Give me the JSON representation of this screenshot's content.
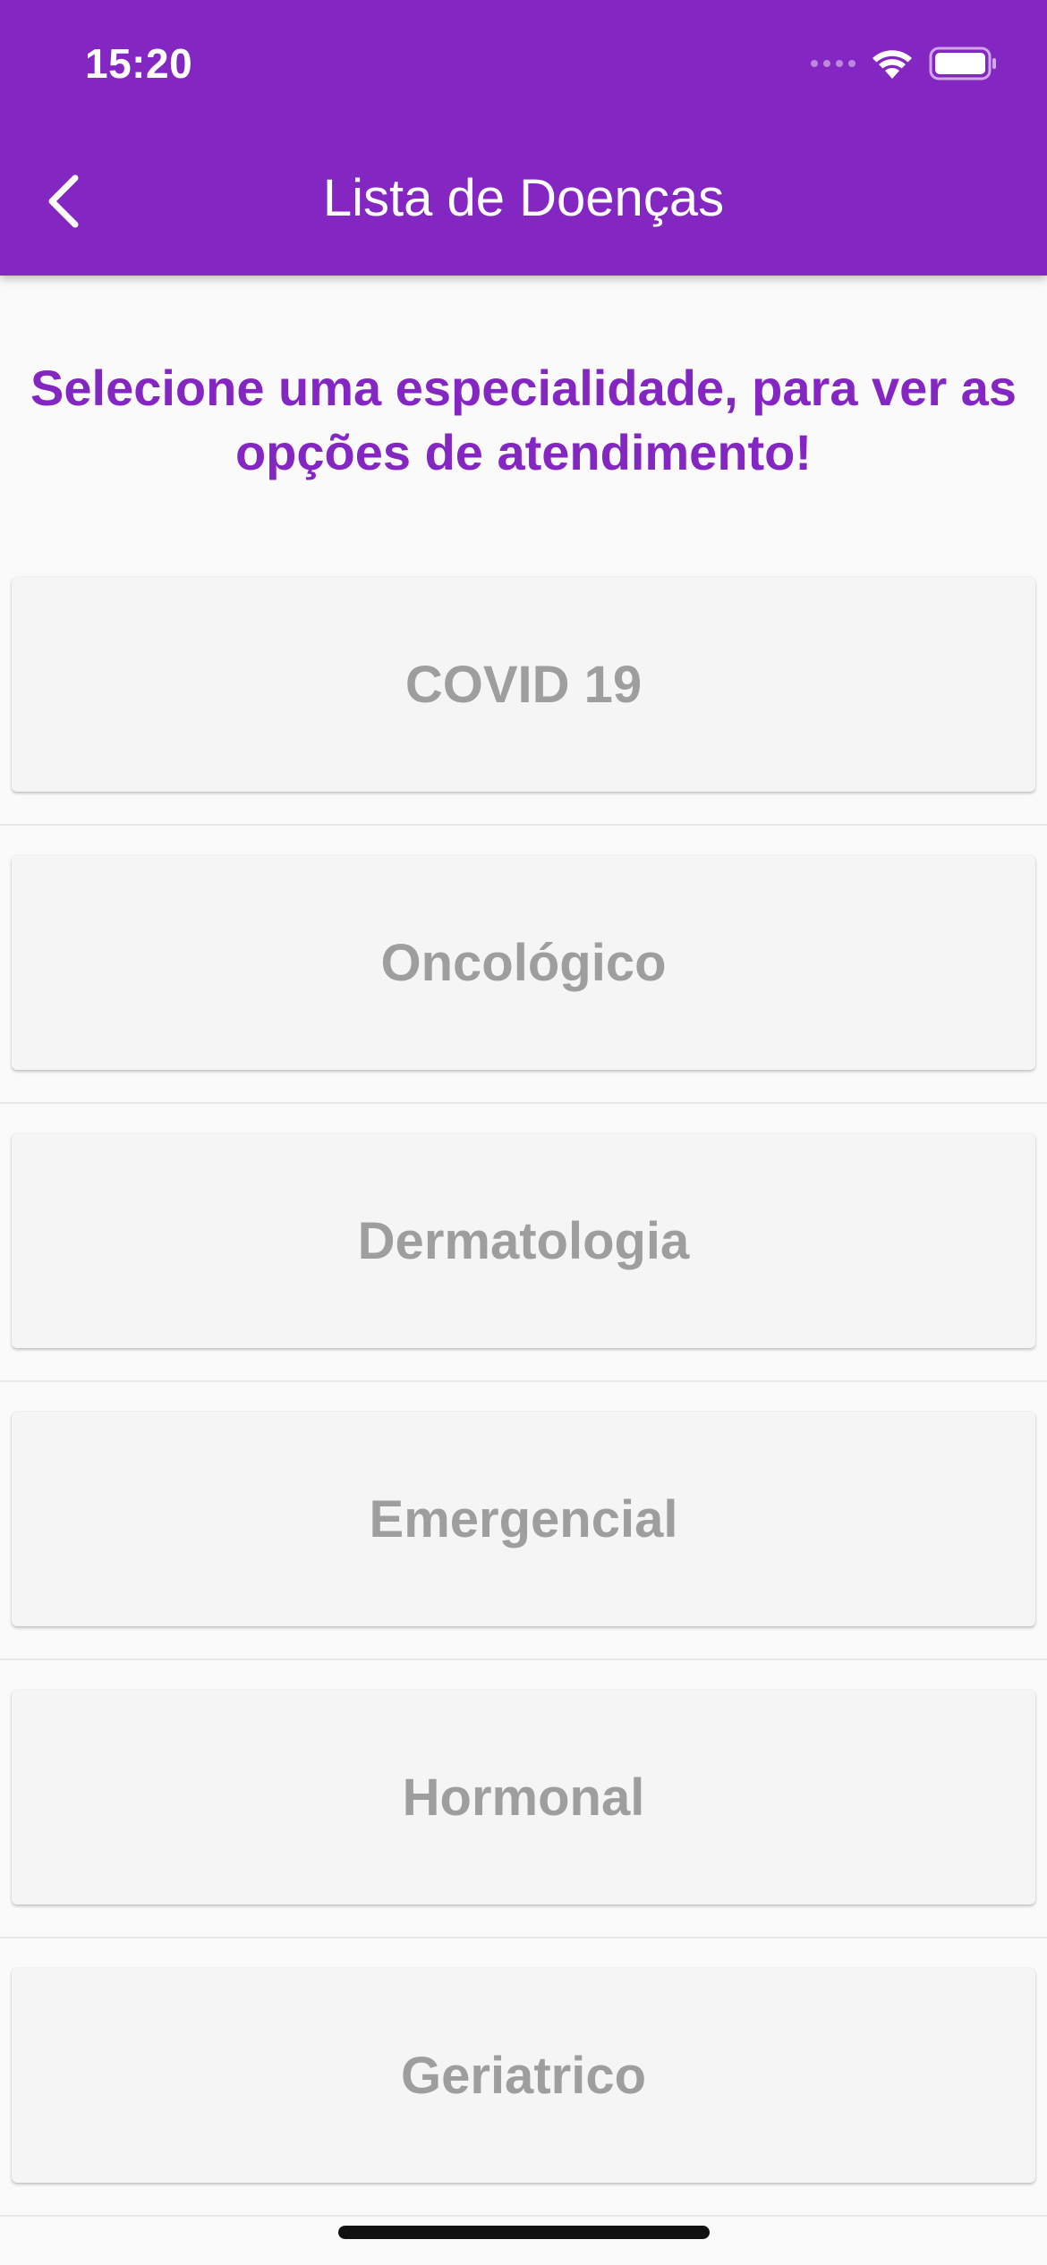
{
  "status_bar": {
    "time": "15:20",
    "icons": [
      "cellular-signal-icon",
      "wifi-icon",
      "battery-icon"
    ]
  },
  "app_bar": {
    "title": "Lista de Doenças",
    "back_icon": "chevron-left-icon",
    "background_color": "#8427c2"
  },
  "headline": "Selecione uma especialidade, para ver as opções de atendimento!",
  "colors": {
    "accent": "#8427c2",
    "card_background": "#f5f5f5",
    "card_text": "#9e9e9e"
  },
  "specialties": [
    {
      "label": "COVID 19"
    },
    {
      "label": "Oncológico"
    },
    {
      "label": "Dermatologia"
    },
    {
      "label": "Emergencial"
    },
    {
      "label": "Hormonal"
    },
    {
      "label": "Geriatrico"
    }
  ]
}
